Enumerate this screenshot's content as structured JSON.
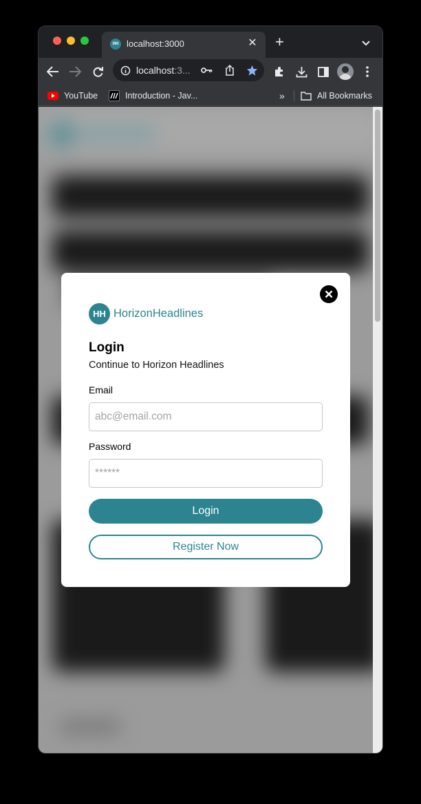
{
  "browser": {
    "tab_title": "localhost:3000",
    "tab_favicon_text": "HH",
    "url_host": "localhost",
    "url_rest": ":3...",
    "bookmarks": [
      {
        "label": "YouTube",
        "icon": "youtube-icon"
      },
      {
        "label": "Introduction - Jav...",
        "icon": "mdn-icon"
      }
    ],
    "bookmarks_overflow": "»",
    "all_bookmarks_label": "All Bookmarks"
  },
  "modal": {
    "brand_badge": "HH",
    "brand_name": "HorizonHeadlines",
    "title": "Login",
    "subtitle": "Continue to Horizon Headlines",
    "email_label": "Email",
    "email_placeholder": "abc@email.com",
    "password_label": "Password",
    "password_placeholder": "******",
    "login_button": "Login",
    "register_button": "Register Now"
  },
  "colors": {
    "brand": "#2b8490",
    "overlay": "#9b9b9b"
  }
}
